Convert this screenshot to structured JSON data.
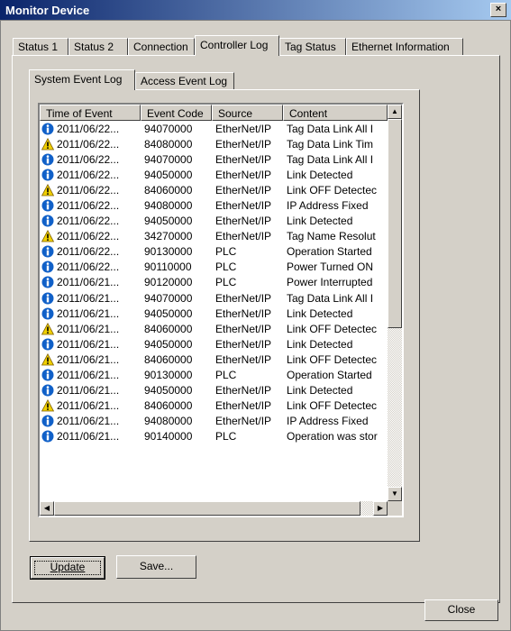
{
  "window": {
    "title": "Monitor Device",
    "close_glyph": "×"
  },
  "tabs": [
    {
      "label": "Status 1"
    },
    {
      "label": "Status 2"
    },
    {
      "label": "Connection"
    },
    {
      "label": "Controller Log"
    },
    {
      "label": "Tag Status"
    },
    {
      "label": "Ethernet Information"
    }
  ],
  "subtabs": [
    {
      "label": "System Event Log"
    },
    {
      "label": "Access Event Log"
    }
  ],
  "table": {
    "columns": [
      "Time of Event",
      "Event Code",
      "Source",
      "Content"
    ],
    "rows": [
      {
        "icon": "info",
        "time": "2011/06/22...",
        "code": "94070000",
        "source": "EtherNet/IP",
        "content": "Tag Data Link All I"
      },
      {
        "icon": "warn",
        "time": "2011/06/22...",
        "code": "84080000",
        "source": "EtherNet/IP",
        "content": "Tag Data Link Tim"
      },
      {
        "icon": "info",
        "time": "2011/06/22...",
        "code": "94070000",
        "source": "EtherNet/IP",
        "content": "Tag Data Link All I"
      },
      {
        "icon": "info",
        "time": "2011/06/22...",
        "code": "94050000",
        "source": "EtherNet/IP",
        "content": "Link Detected"
      },
      {
        "icon": "warn",
        "time": "2011/06/22...",
        "code": "84060000",
        "source": "EtherNet/IP",
        "content": "Link OFF Detectec"
      },
      {
        "icon": "info",
        "time": "2011/06/22...",
        "code": "94080000",
        "source": "EtherNet/IP",
        "content": "IP Address Fixed"
      },
      {
        "icon": "info",
        "time": "2011/06/22...",
        "code": "94050000",
        "source": "EtherNet/IP",
        "content": "Link Detected"
      },
      {
        "icon": "warn",
        "time": "2011/06/22...",
        "code": "34270000",
        "source": "EtherNet/IP",
        "content": "Tag Name Resolut"
      },
      {
        "icon": "info",
        "time": "2011/06/22...",
        "code": "90130000",
        "source": "PLC",
        "content": "Operation Started"
      },
      {
        "icon": "info",
        "time": "2011/06/22...",
        "code": "90110000",
        "source": "PLC",
        "content": "Power Turned ON"
      },
      {
        "icon": "info",
        "time": "2011/06/21...",
        "code": "90120000",
        "source": "PLC",
        "content": "Power Interrupted"
      },
      {
        "icon": "info",
        "time": "2011/06/21...",
        "code": "94070000",
        "source": "EtherNet/IP",
        "content": "Tag Data Link All I"
      },
      {
        "icon": "info",
        "time": "2011/06/21...",
        "code": "94050000",
        "source": "EtherNet/IP",
        "content": "Link Detected"
      },
      {
        "icon": "warn",
        "time": "2011/06/21...",
        "code": "84060000",
        "source": "EtherNet/IP",
        "content": "Link OFF Detectec"
      },
      {
        "icon": "info",
        "time": "2011/06/21...",
        "code": "94050000",
        "source": "EtherNet/IP",
        "content": "Link Detected"
      },
      {
        "icon": "warn",
        "time": "2011/06/21...",
        "code": "84060000",
        "source": "EtherNet/IP",
        "content": "Link OFF Detectec"
      },
      {
        "icon": "info",
        "time": "2011/06/21...",
        "code": "90130000",
        "source": "PLC",
        "content": "Operation Started"
      },
      {
        "icon": "info",
        "time": "2011/06/21...",
        "code": "94050000",
        "source": "EtherNet/IP",
        "content": "Link Detected"
      },
      {
        "icon": "warn",
        "time": "2011/06/21...",
        "code": "84060000",
        "source": "EtherNet/IP",
        "content": "Link OFF Detectec"
      },
      {
        "icon": "info",
        "time": "2011/06/21...",
        "code": "94080000",
        "source": "EtherNet/IP",
        "content": "IP Address Fixed"
      },
      {
        "icon": "info",
        "time": "2011/06/21...",
        "code": "90140000",
        "source": "PLC",
        "content": "Operation was stor"
      }
    ]
  },
  "buttons": {
    "update": "Update",
    "save": "Save...",
    "close": "Close"
  },
  "colors": {
    "info": "#1060c8",
    "warn": "#f0d000",
    "titlebar": "#0a246a"
  }
}
